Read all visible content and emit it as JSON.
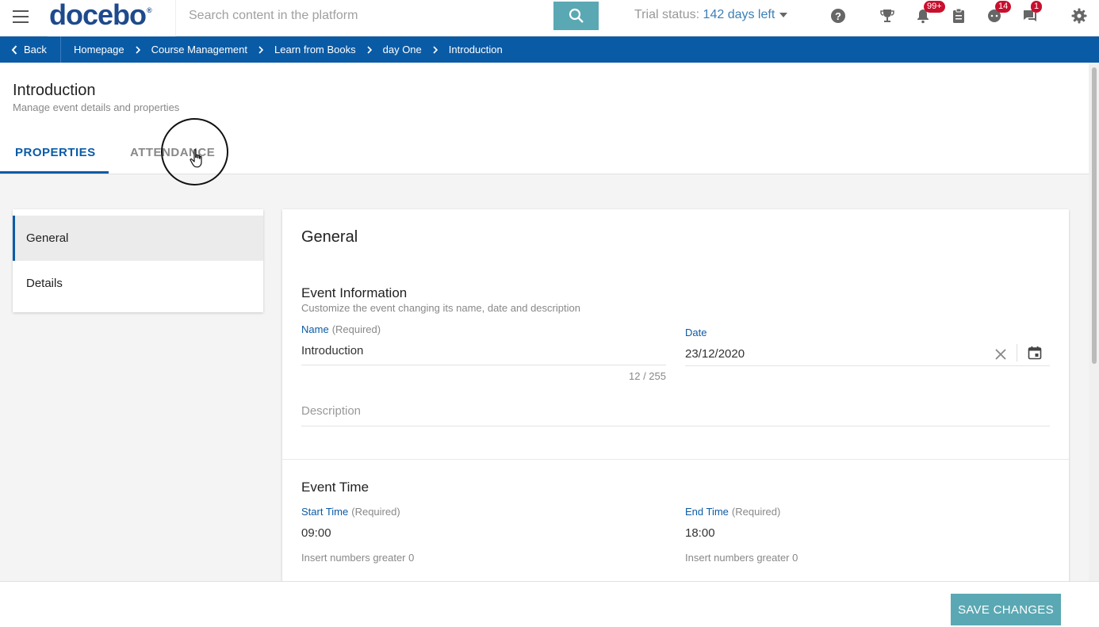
{
  "topbar": {
    "logo": "docebo",
    "logo_mark": "®",
    "search_placeholder": "Search content in the platform",
    "trial_prefix": "Trial status: ",
    "trial_days": "142 days left",
    "badges": {
      "notifications": "99+",
      "chat": "14",
      "messages": "1"
    }
  },
  "breadcrumb": {
    "back_label": "Back",
    "items": [
      "Homepage",
      "Course Management",
      "Learn from Books",
      "day One",
      "Introduction"
    ]
  },
  "header": {
    "title": "Introduction",
    "subtitle": "Manage event details and properties",
    "tabs": [
      "PROPERTIES",
      "ATTENDANCE"
    ]
  },
  "leftnav": {
    "items": [
      "General",
      "Details"
    ]
  },
  "card": {
    "title": "General",
    "event_info": {
      "title": "Event Information",
      "subtitle": "Customize the event changing its name, date and description",
      "name_label": "Name",
      "name_required": "(Required)",
      "name_value": "Introduction",
      "name_counter": "12 / 255",
      "date_label": "Date",
      "date_value": "23/12/2020",
      "description_placeholder": "Description"
    },
    "event_time": {
      "title": "Event Time",
      "start_label": "Start Time",
      "start_required": "(Required)",
      "start_value": "09:00",
      "start_hint": "Insert numbers greater 0",
      "end_label": "End Time",
      "end_required": "(Required)",
      "end_value": "18:00",
      "end_hint": "Insert numbers greater 0"
    }
  },
  "footer": {
    "save_label": "SAVE CHANGES"
  },
  "colors": {
    "primary": "#0a5ba6",
    "accent": "#5aa8b3",
    "badge": "#c8102e"
  }
}
